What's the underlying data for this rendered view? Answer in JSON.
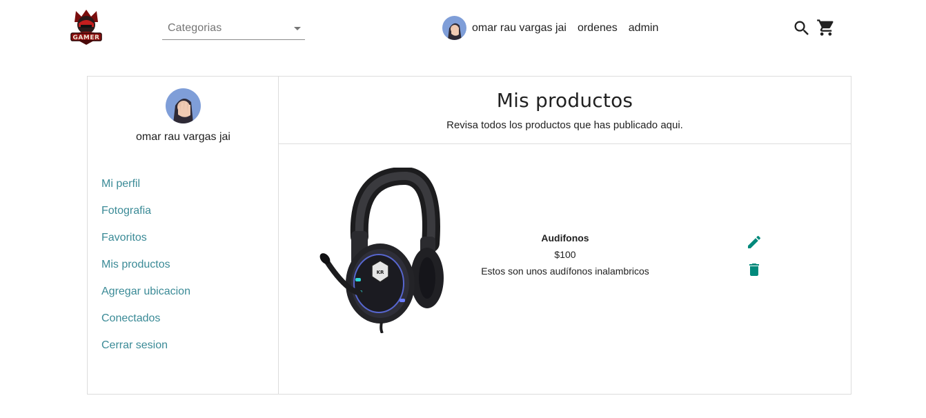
{
  "header": {
    "logo_text": "GAMER",
    "category_select": {
      "placeholder": "Categorias"
    },
    "user_name": "omar rau vargas jai",
    "links": {
      "orders": "ordenes",
      "admin": "admin"
    }
  },
  "sidebar": {
    "user_name": "omar rau vargas jai",
    "items": [
      {
        "label": "Mi perfil"
      },
      {
        "label": "Fotografia"
      },
      {
        "label": "Favoritos"
      },
      {
        "label": "Mis productos"
      },
      {
        "label": "Agregar ubicacion"
      },
      {
        "label": "Conectados"
      },
      {
        "label": "Cerrar sesion"
      }
    ]
  },
  "main": {
    "title": "Mis productos",
    "subtitle": "Revisa todos los productos que has publicado aqui.",
    "product": {
      "name": "Audifonos",
      "price": "$100",
      "description": "Estos son unos audífonos inalambricos"
    }
  },
  "colors": {
    "accent": "#00897b",
    "link": "#3a8a96",
    "border": "#dcdcdc"
  }
}
